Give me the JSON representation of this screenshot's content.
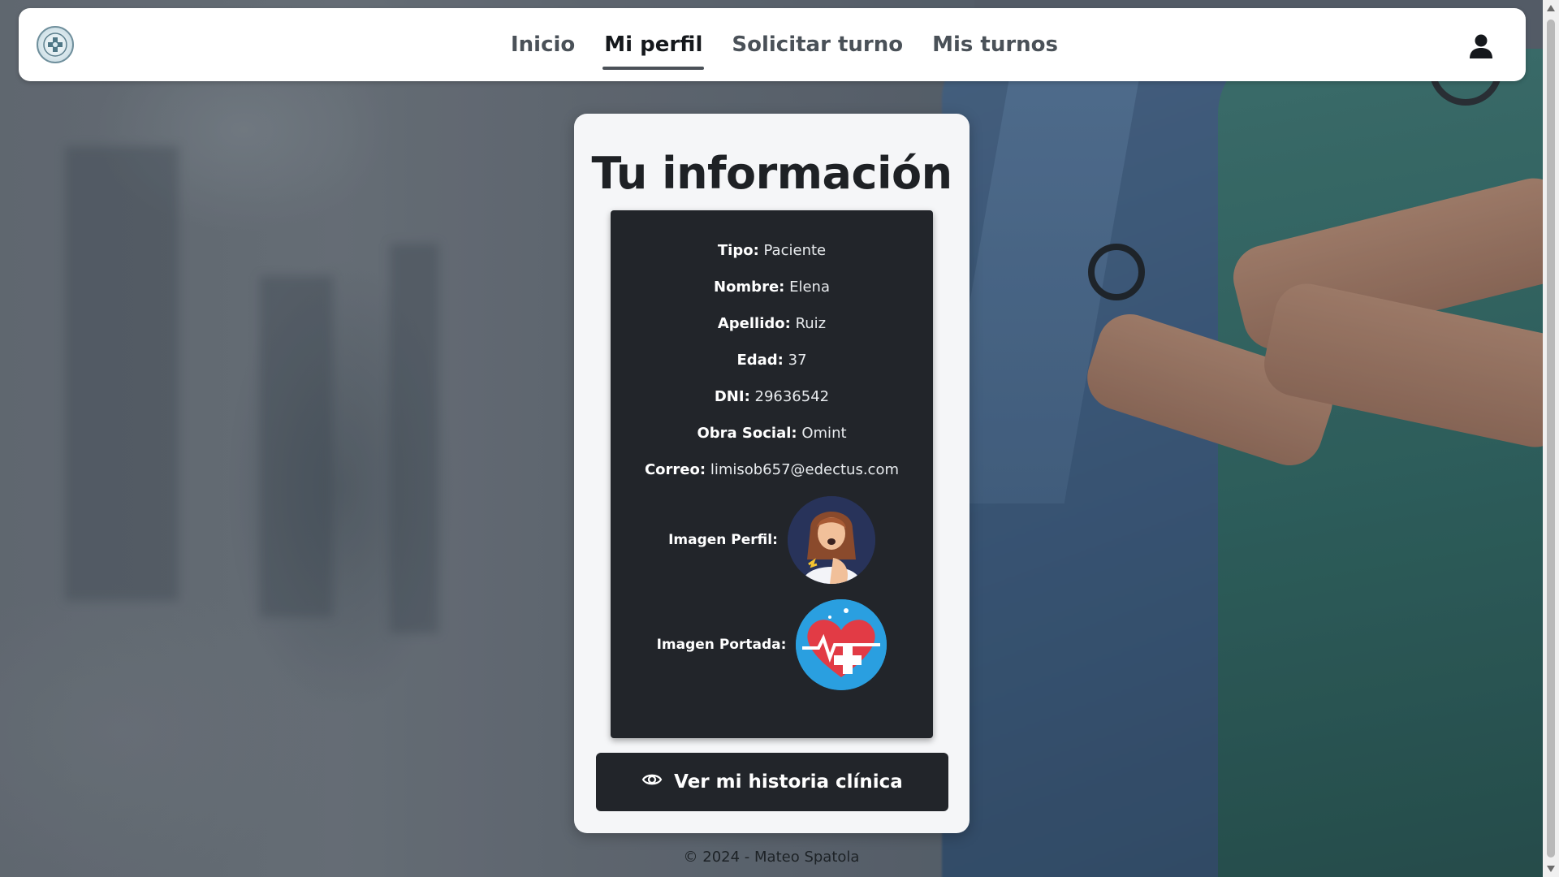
{
  "navbar": {
    "logo_icon": "clinic-logo-icon",
    "links": [
      {
        "label": "Inicio",
        "active": false
      },
      {
        "label": "Mi perfil",
        "active": true
      },
      {
        "label": "Solicitar turno",
        "active": false
      },
      {
        "label": "Mis turnos",
        "active": false
      }
    ],
    "user_icon": "user-icon"
  },
  "card": {
    "title": "Tu información",
    "fields": [
      {
        "label": "Tipo:",
        "value": "Paciente"
      },
      {
        "label": "Nombre:",
        "value": "Elena"
      },
      {
        "label": "Apellido:",
        "value": "Ruiz"
      },
      {
        "label": "Edad:",
        "value": "37"
      },
      {
        "label": "DNI:",
        "value": "29636542"
      },
      {
        "label": "Obra Social:",
        "value": "Omint"
      },
      {
        "label": "Correo:",
        "value": "limisob657@edectus.com"
      }
    ],
    "profile_image_label": "Imagen Perfil:",
    "cover_image_label": "Imagen Portada:",
    "history_button": {
      "label": "Ver mi historia clínica",
      "icon": "eye-icon"
    }
  },
  "footer": {
    "text": "© 2024 - Mateo Spatola"
  },
  "colors": {
    "panel_dark": "#22252a",
    "card_bg": "#f5f6f8",
    "navbar_bg": "#ffffff"
  }
}
